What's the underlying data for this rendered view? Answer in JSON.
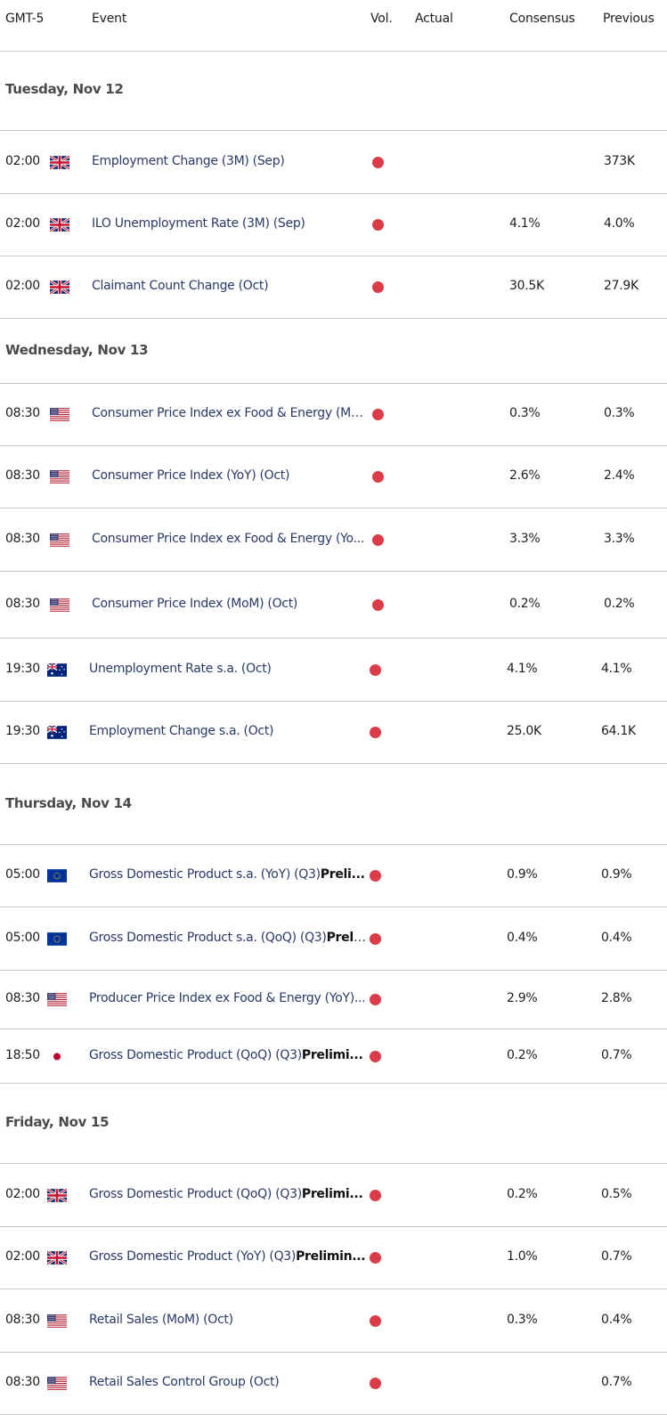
{
  "header": {
    "timezone": "GMT-5",
    "event": "Event",
    "vol": "Vol.",
    "actual": "Actual",
    "consensus": "Consensus",
    "previous": "Previous"
  },
  "colors": {
    "volatility_high": "#dc3b48",
    "event_text": "#2a3a66"
  },
  "days": [
    {
      "label": "Tuesday, Nov 12",
      "events": [
        {
          "time": "02:00",
          "country": "GB",
          "flag_icon": "uk-flag-icon",
          "name": "Employment Change (3M) (Sep)",
          "bold": "",
          "volatility": "high",
          "actual": "",
          "consensus": "",
          "previous": "373K"
        },
        {
          "time": "02:00",
          "country": "GB",
          "flag_icon": "uk-flag-icon",
          "name": "ILO Unemployment Rate (3M) (Sep)",
          "bold": "",
          "volatility": "high",
          "actual": "",
          "consensus": "4.1%",
          "previous": "4.0%"
        },
        {
          "time": "02:00",
          "country": "GB",
          "flag_icon": "uk-flag-icon",
          "name": "Claimant Count Change (Oct)",
          "bold": "",
          "volatility": "high",
          "actual": "",
          "consensus": "30.5K",
          "previous": "27.9K"
        }
      ]
    },
    {
      "label": "Wednesday, Nov 13",
      "events": [
        {
          "time": "08:30",
          "country": "US",
          "flag_icon": "us-flag-icon",
          "name": "Consumer Price Index ex Food & Energy (Mo...",
          "bold": "",
          "volatility": "high",
          "actual": "",
          "consensus": "0.3%",
          "previous": "0.3%"
        },
        {
          "time": "08:30",
          "country": "US",
          "flag_icon": "us-flag-icon",
          "name": "Consumer Price Index (YoY) (Oct)",
          "bold": "",
          "volatility": "high",
          "actual": "",
          "consensus": "2.6%",
          "previous": "2.4%"
        },
        {
          "time": "08:30",
          "country": "US",
          "flag_icon": "us-flag-icon",
          "name": "Consumer Price Index ex Food & Energy (Yo...",
          "bold": "",
          "volatility": "high",
          "actual": "",
          "consensus": "3.3%",
          "previous": "3.3%"
        },
        {
          "time": "08:30",
          "country": "US",
          "flag_icon": "us-flag-icon",
          "name": "Consumer Price Index (MoM) (Oct)",
          "bold": "",
          "volatility": "high",
          "actual": "",
          "consensus": "0.2%",
          "previous": "0.2%"
        },
        {
          "time": "19:30",
          "country": "AU",
          "flag_icon": "australia-flag-icon",
          "name": "Unemployment Rate s.a. (Oct)",
          "bold": "",
          "volatility": "high",
          "actual": "",
          "consensus": "4.1%",
          "previous": "4.1%"
        },
        {
          "time": "19:30",
          "country": "AU",
          "flag_icon": "australia-flag-icon",
          "name": "Employment Change s.a. (Oct)",
          "bold": "",
          "volatility": "high",
          "actual": "",
          "consensus": "25.0K",
          "previous": "64.1K"
        }
      ]
    },
    {
      "label": "Thursday, Nov 14",
      "events": [
        {
          "time": "05:00",
          "country": "EU",
          "flag_icon": "eu-flag-icon",
          "name": "Gross Domestic Product s.a. (YoY) (Q3)",
          "bold": "Preli...",
          "volatility": "high",
          "actual": "",
          "consensus": "0.9%",
          "previous": "0.9%"
        },
        {
          "time": "05:00",
          "country": "EU",
          "flag_icon": "eu-flag-icon",
          "name": "Gross Domestic Product s.a. (QoQ) (Q3)",
          "bold": "Prel...",
          "volatility": "high",
          "actual": "",
          "consensus": "0.4%",
          "previous": "0.4%"
        },
        {
          "time": "08:30",
          "country": "US",
          "flag_icon": "us-flag-icon",
          "name": "Producer Price Index ex Food & Energy (YoY)...",
          "bold": "",
          "volatility": "high",
          "actual": "",
          "consensus": "2.9%",
          "previous": "2.8%"
        },
        {
          "time": "18:50",
          "country": "JP",
          "flag_icon": "japan-flag-icon",
          "name": "Gross Domestic Product (QoQ) (Q3)",
          "bold": "Prelimi...",
          "volatility": "high",
          "actual": "",
          "consensus": "0.2%",
          "previous": "0.7%"
        }
      ]
    },
    {
      "label": "Friday, Nov 15",
      "events": [
        {
          "time": "02:00",
          "country": "GB",
          "flag_icon": "uk-flag-icon",
          "name": "Gross Domestic Product (QoQ) (Q3)",
          "bold": "Prelimi...",
          "volatility": "high",
          "actual": "",
          "consensus": "0.2%",
          "previous": "0.5%"
        },
        {
          "time": "02:00",
          "country": "GB",
          "flag_icon": "uk-flag-icon",
          "name": "Gross Domestic Product (YoY) (Q3)",
          "bold": "Prelimin...",
          "volatility": "high",
          "actual": "",
          "consensus": "1.0%",
          "previous": "0.7%"
        },
        {
          "time": "08:30",
          "country": "US",
          "flag_icon": "us-flag-icon",
          "name": "Retail Sales (MoM) (Oct)",
          "bold": "",
          "volatility": "high",
          "actual": "",
          "consensus": "0.3%",
          "previous": "0.4%"
        },
        {
          "time": "08:30",
          "country": "US",
          "flag_icon": "us-flag-icon",
          "name": "Retail Sales Control Group (Oct)",
          "bold": "",
          "volatility": "high",
          "actual": "",
          "consensus": "",
          "previous": "0.7%"
        }
      ]
    }
  ]
}
